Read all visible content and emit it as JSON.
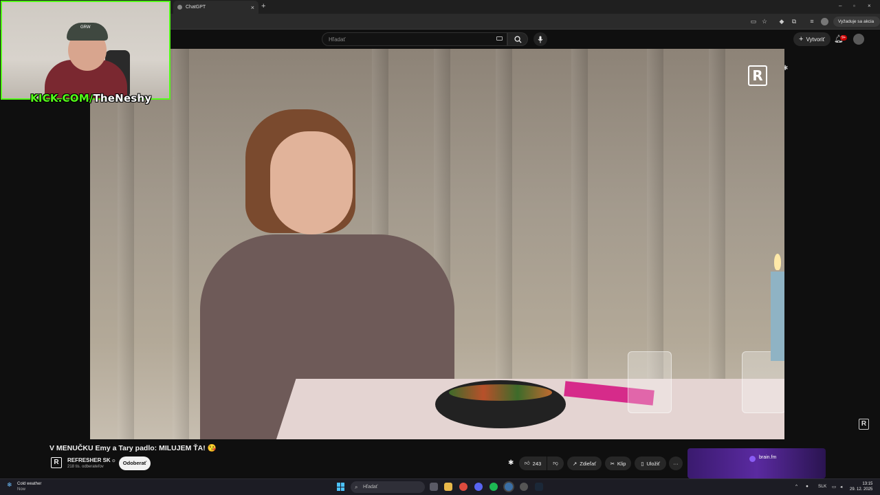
{
  "browser": {
    "tab_title": "ChatGPT",
    "new_tab_symbol": "+",
    "update_label": "Vyžaduje sa akcia"
  },
  "youtube_header": {
    "search_placeholder": "Hľadať",
    "create_label": "Vytvoriť",
    "notification_count": "9+"
  },
  "webcam": {
    "kick_prefix": "KICK.COM/",
    "streamer": "TheNeshy",
    "cap_text": "GRW"
  },
  "video": {
    "title": "V MENUČKU Emy a Tary padlo: MILUJEM ŤA! 😘",
    "channel_name": "REFRESHER SK",
    "subscribers": "218 tis. odberateľov",
    "subscribe_label": "Odoberať",
    "likes": "243",
    "share_label": "Zdieľať",
    "clip_label": "Klip",
    "save_label": "Uložiť",
    "more_label": "···"
  },
  "ad": {
    "brand": "brain.fm"
  },
  "taskbar": {
    "weather_title": "Cold weather",
    "weather_sub": "Now",
    "search_label": "Hľadať",
    "language": "SLK",
    "time": "13:15",
    "date": "29. 12. 2025"
  },
  "colors": {
    "kick_green": "#53fc18",
    "youtube_bg": "#0f0f0f",
    "notification_red": "#cc0000"
  }
}
